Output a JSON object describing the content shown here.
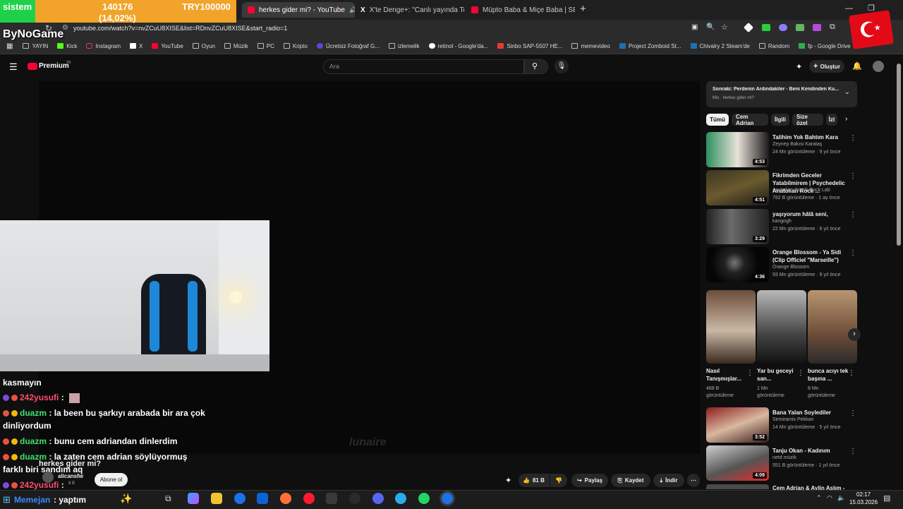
{
  "overlay": {
    "stream_label": "sistem",
    "count": "140176",
    "percent": "(14,02%)",
    "goal": "TRY100000",
    "channel": "ByNoGame"
  },
  "browser": {
    "tabs": [
      {
        "title": "herkes gider mi? - YouTube",
        "active": true
      },
      {
        "title": "X'te Denge+: \"Canlı yayında Te",
        "active": false
      },
      {
        "title": "Müpto Baba & Miçe Baba | SEL",
        "active": false
      }
    ],
    "new_tab": "+",
    "url": "youtube.com/watch?v=nvZCuU8XISE&list=RDnvZCuU8XISE&start_radio=1",
    "bookmarks": [
      "YAYIN",
      "Kick",
      "Instagram",
      "X",
      "YouTube",
      "Oyun",
      "Müzik",
      "PC",
      "Kripto",
      "Ücretsiz Fotoğraf G...",
      "izlemelik",
      "retinol - Google'da...",
      "Sinbo SAP-5507 HE...",
      "memevideo",
      "Project Zomboid St...",
      "Chivalry 2 Steam'de",
      "Random",
      "fp - Google Drive"
    ]
  },
  "youtube": {
    "logo": "Premium",
    "logo_sup": "TR",
    "search_placeholder": "Ara",
    "create": "Oluştur",
    "watermark": "lunaire",
    "video_title": "herkes gider mi?",
    "channel": "alicansfw",
    "subs": "8 B",
    "subscribe": "Abone ol",
    "likes": "81 B",
    "share": "Paylaş",
    "save": "Kaydet",
    "download": "İndir",
    "next": {
      "title": "Sonraki: Perdenin Ardındakiler - Beni Kendinden Ku...",
      "sub": "Mix · herkes gider mi?"
    },
    "chips": [
      "Tümü",
      "Cem Adrian",
      "İlgili",
      "Size özel",
      "İzl"
    ],
    "videos": [
      {
        "title": "Talihim Yok Bahtım Kara",
        "channel": "Zeynep Bakısi Karataş",
        "meta": "24 Mn görüntüleme · 9 yıl önce",
        "duration": "4:53"
      },
      {
        "title": "Fikrimden Geceler Yatabilmirem | Psychedelic Anatolian Rock ...",
        "channel": "Anatolian Psych Rock Lab",
        "meta": "782 B görüntüleme · 1 ay önce",
        "duration": "4:51"
      },
      {
        "title": "yaşıyorum hâlâ seni,",
        "channel": "kangogh",
        "meta": "22 Mn görüntüleme · 6 yıl önce",
        "duration": "3:29"
      },
      {
        "title": "Orange Blossom - Ya Sidi (Clip Officiel \"Marseille\")",
        "channel": "Orange Blossom",
        "meta": "93 Mn görüntüleme · 9 yıl önce",
        "duration": "4:36"
      }
    ],
    "shorts": [
      {
        "title": "Nasıl Tanışmışlar...",
        "views": "468 B görüntüleme"
      },
      {
        "title": "Yar bu geceyi san...",
        "views": "1 Mn görüntüleme"
      },
      {
        "title": "bunca acıyı tek başına ...",
        "views": "8 Mn görüntüleme"
      }
    ],
    "videos2": [
      {
        "title": "Bana Yalan Soylediler",
        "channel": "Semiramis Pekkan",
        "meta": "14 Mn görüntüleme · 5 yıl önce",
        "duration": "3:52"
      },
      {
        "title": "Tanju Okan - Kadınım",
        "channel": "netd müzik",
        "meta": "551 B görüntüleme · 1 yıl önce",
        "duration": "4:09"
      },
      {
        "title": "Cem Adrian & Aylin Aslım -"
      }
    ]
  },
  "chat": [
    {
      "user": "",
      "text": "kasmayın"
    },
    {
      "user": "242yusufi",
      "text": ":"
    },
    {
      "user": "duazm",
      "text": ": la been bu şarkıyı arabada bir ara çok"
    },
    {
      "user": "",
      "text": "dinliyordum"
    },
    {
      "user": "duazm",
      "text": ": bunu cem adriandan dinlerdim"
    },
    {
      "user": "duazm",
      "text": ": la zaten cem adrian söylüyormuş"
    },
    {
      "user": "",
      "text": "farklı biri sandım aq"
    },
    {
      "user": "242yusufi",
      "text": ":"
    },
    {
      "user": "Memejan",
      "text": ": yaptım"
    }
  ],
  "taskbar": {
    "time": "02:17",
    "date": "15.03.2026"
  }
}
